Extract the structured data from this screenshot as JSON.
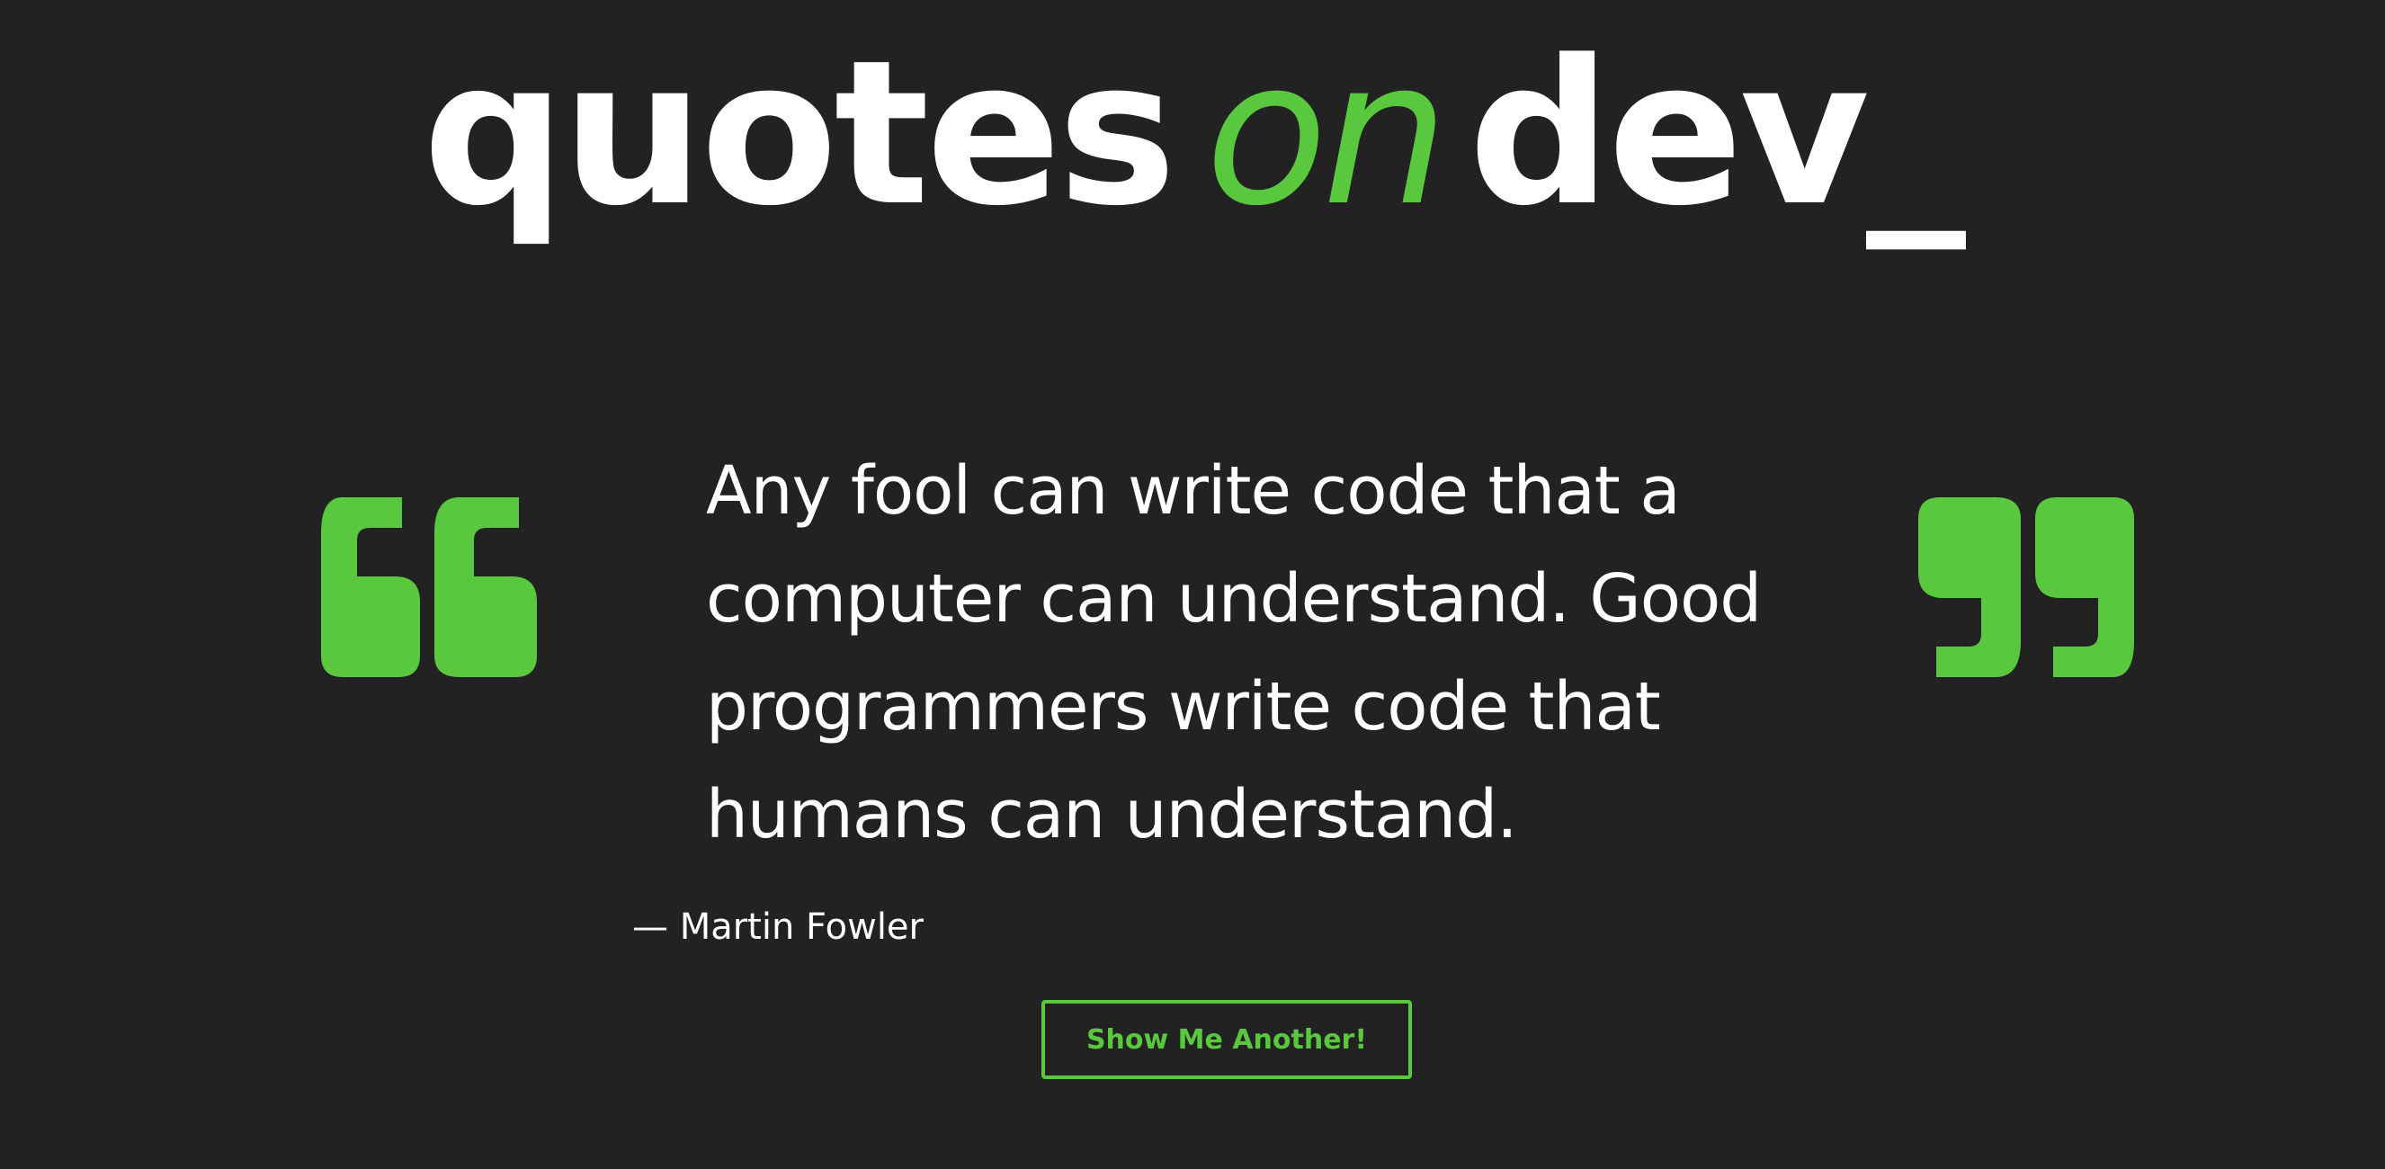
{
  "logo": {
    "word1": "quotes",
    "word2": "on",
    "word3": "dev_"
  },
  "quote": {
    "text": "Any fool can write code that a computer can understand. Good programmers write code that humans can understand.",
    "author": "— Martin Fowler"
  },
  "button": {
    "label": "Show Me Another!"
  },
  "colors": {
    "background": "#222222",
    "accent": "#5ac83e",
    "text": "#ffffff"
  },
  "icons": {
    "open_quote": "open-quote-icon",
    "close_quote": "close-quote-icon"
  }
}
